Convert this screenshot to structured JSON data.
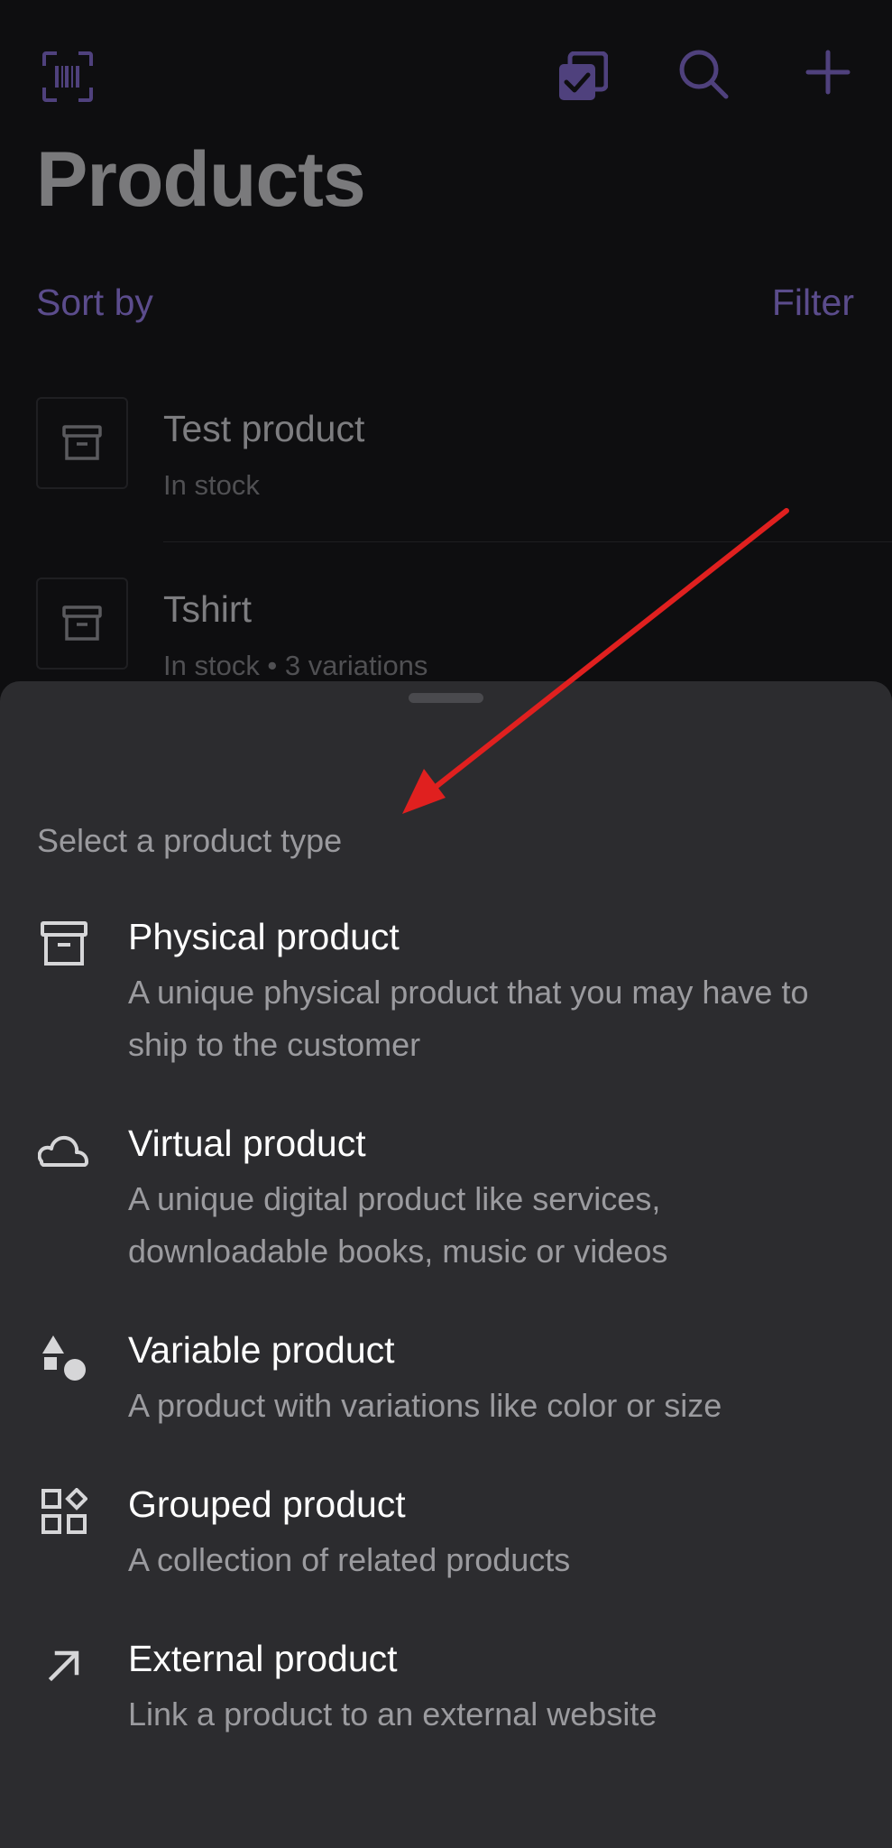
{
  "header": {
    "title": "Products",
    "sort_label": "Sort by",
    "filter_label": "Filter",
    "icons": [
      "barcode-scan-icon",
      "bulk-select-icon",
      "search-icon",
      "plus-icon"
    ]
  },
  "products": [
    {
      "name": "Test product",
      "meta": "In stock"
    },
    {
      "name": "Tshirt",
      "meta": "In stock • 3 variations"
    }
  ],
  "sheet": {
    "title": "Select a product type",
    "options": [
      {
        "icon": "archive-box-icon",
        "title": "Physical product",
        "desc": "A unique physical product that you may have to ship to the customer"
      },
      {
        "icon": "cloud-icon",
        "title": "Virtual product",
        "desc": "A unique digital product like services, downloadable books, music or videos"
      },
      {
        "icon": "shapes-icon",
        "title": "Variable product",
        "desc": "A product with variations like color or size"
      },
      {
        "icon": "grid-blocks-icon",
        "title": "Grouped product",
        "desc": "A collection of related products"
      },
      {
        "icon": "arrow-up-right-icon",
        "title": "External product",
        "desc": "Link a product to an external website"
      }
    ]
  },
  "colors": {
    "accent": "#5b4c8c",
    "background": "#0e0e10",
    "sheet": "#2c2c2f",
    "annotation_arrow": "#e0201f"
  }
}
